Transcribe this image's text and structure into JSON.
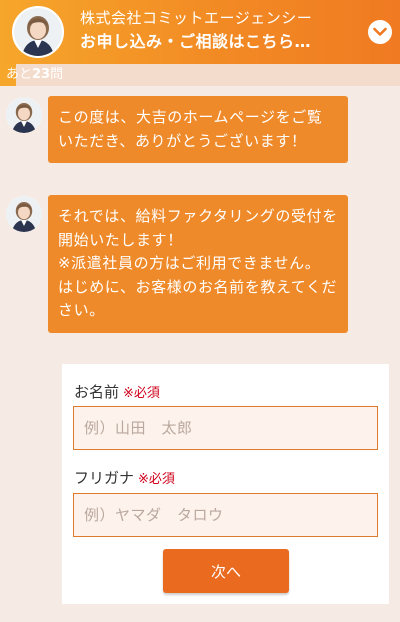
{
  "header": {
    "company": "株式会社コミットエージェンシー",
    "cta": "お申し込み・ご相談はこちら…",
    "chevron_icon": "chevron-down-icon",
    "avatar_icon": "operator-avatar"
  },
  "progress": {
    "prefix": "あと",
    "count": "23",
    "suffix": "問"
  },
  "messages": [
    {
      "text": "この度は、大吉のホームページをご覧いただき、ありがとうございます！"
    },
    {
      "text": "それでは、給料ファクタリングの受付を開始いたします！\n※派遣社員の方はご利用できません。\nはじめに、お客様のお名前を教えてください。"
    }
  ],
  "form": {
    "name": {
      "label": "お名前",
      "required": "※必須",
      "placeholder": "例）山田　太郎",
      "value": ""
    },
    "kana": {
      "label": "フリガナ",
      "required": "※必須",
      "placeholder": "例）ヤマダ　タロウ",
      "value": ""
    },
    "next_label": "次へ"
  },
  "colors": {
    "accent": "#ef8a2a",
    "button": "#ea6a1f",
    "required": "#d0021b",
    "background": "#f5ebe4"
  }
}
